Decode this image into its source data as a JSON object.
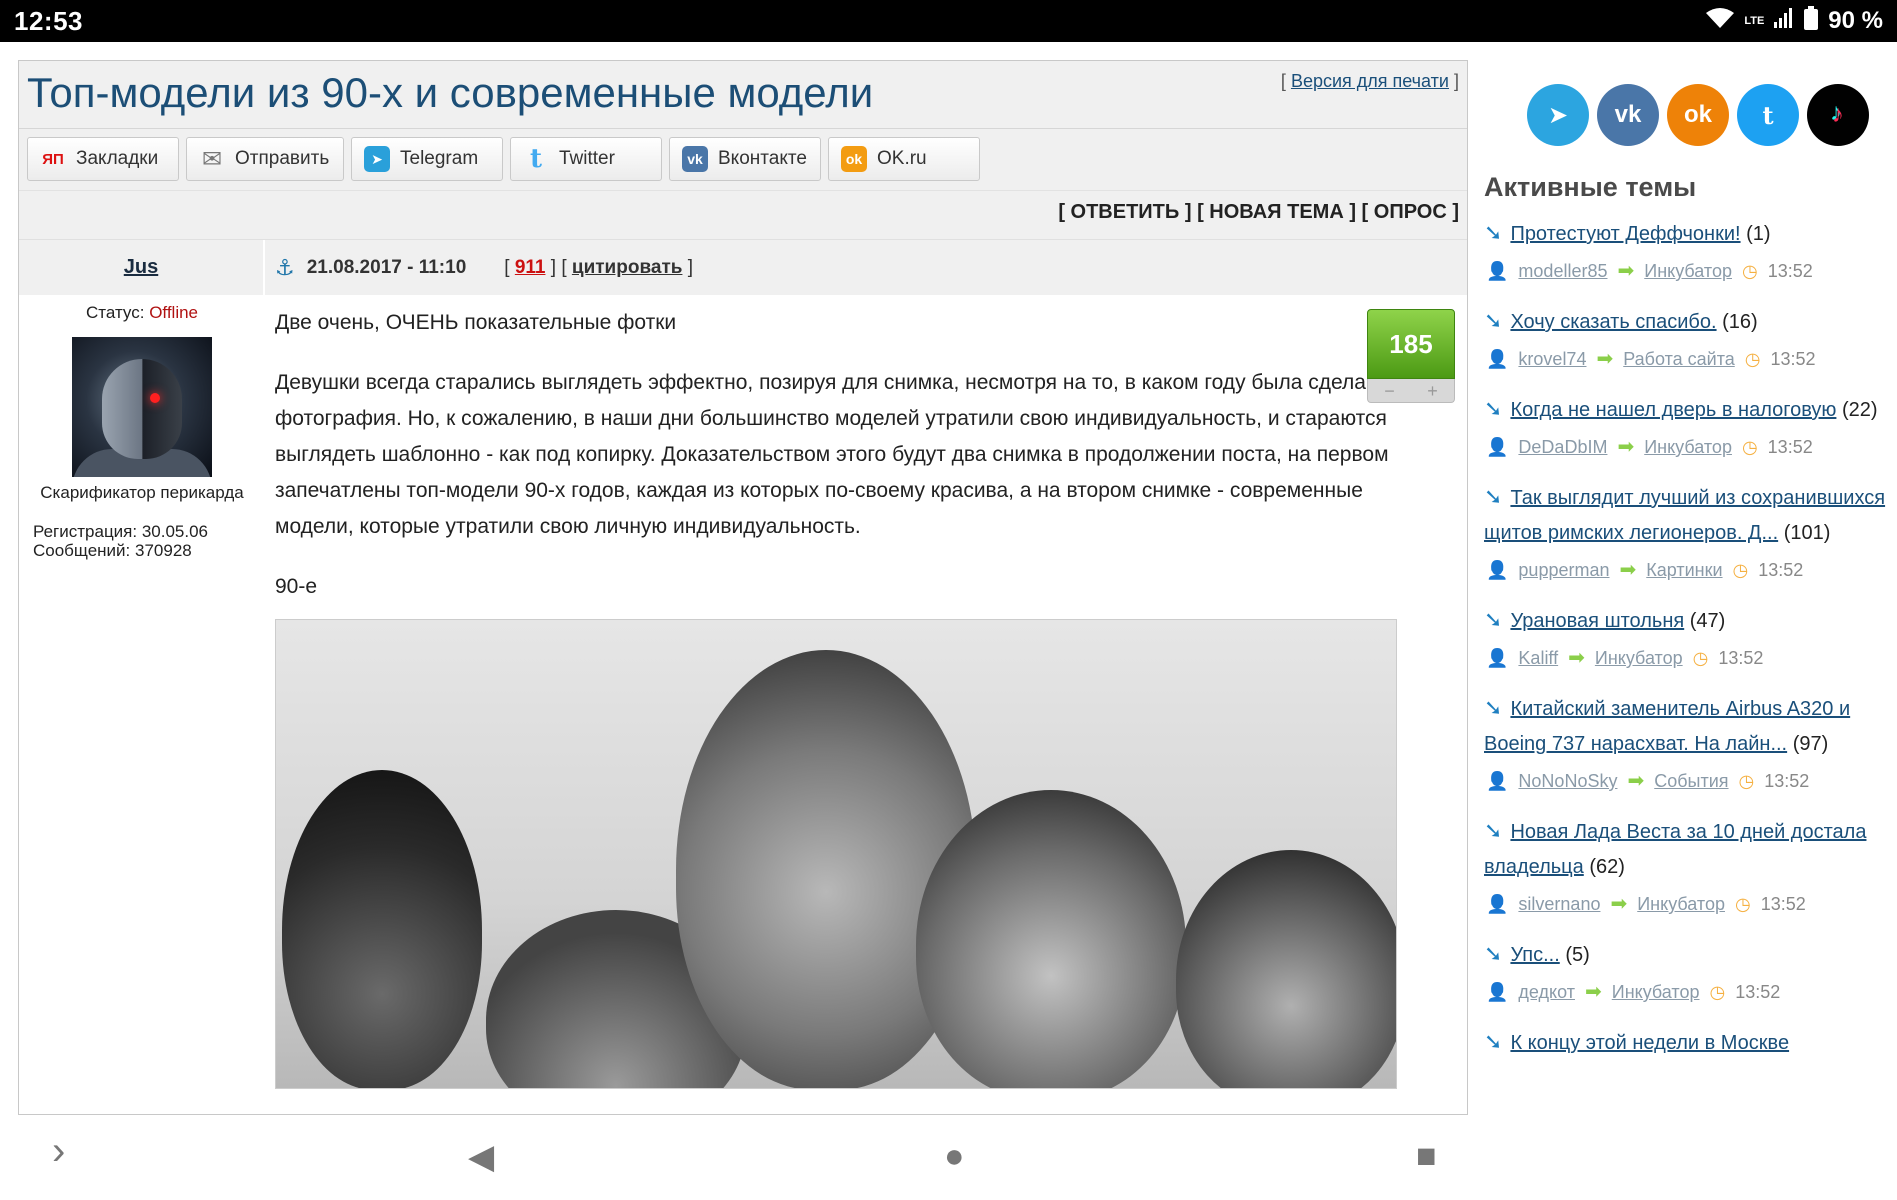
{
  "status_bar": {
    "time": "12:53",
    "network": "LTE",
    "battery": "90 %"
  },
  "page": {
    "title": "Топ-модели из 90-х и современные модели",
    "print_link": "Версия для печати"
  },
  "share": [
    {
      "label": "Закладки",
      "icon": "yandex-icon",
      "icon_text": "ЯП",
      "color": "#d11"
    },
    {
      "label": "Отправить",
      "icon": "mail-icon",
      "icon_text": "✉",
      "color": "#777"
    },
    {
      "label": "Telegram",
      "icon": "telegram-icon",
      "icon_text": "➤",
      "color": "#2aa0da"
    },
    {
      "label": "Twitter",
      "icon": "twitter-icon",
      "icon_text": "t",
      "color": "#42aaf0"
    },
    {
      "label": "Вконтакте",
      "icon": "vk-icon",
      "icon_text": "vk",
      "color": "#4a76a8"
    },
    {
      "label": "OK.ru",
      "icon": "ok-icon",
      "icon_text": "ok",
      "color": "#f39c12"
    }
  ],
  "actions": {
    "reply": "[ ОТВЕТИТЬ ]",
    "new_topic": "[ НОВАЯ ТЕМА ]",
    "poll": "[ ОПРОС ]"
  },
  "post": {
    "author": "Jus",
    "date": "21.08.2017 - 11:10",
    "number": "911",
    "quote": "цитировать",
    "status_label": "Статус:",
    "status_value": "Offline",
    "rank": "Скарификатор перикарда",
    "registration": "Регистрация: 30.05.06",
    "messages": "Сообщений: 370928",
    "rating": "185",
    "rating_minus": "−",
    "rating_plus": "+",
    "paragraphs": [
      "Две очень, ОЧЕНЬ показательные фотки",
      "Девушки всегда старались выглядеть эффектно, позируя для снимка, несмотря на то, в каком году была сделана фотография. Но, к сожалению, в наши дни большинство моделей утратили свою индивидуальность, и стараются выглядеть шаблонно - как под копирку. Доказательством этого будут два снимка в продолжении поста, на первом запечатлены топ-модели 90-х годов, каждая из которых по-своему красива, а на втором снимке - современные модели, которые утратили свою личную индивидуальность.",
      "90-е"
    ]
  },
  "sidebar": {
    "socials": [
      {
        "name": "telegram",
        "icon": "telegram-icon",
        "glyph": "➤",
        "color": "#2ca5e0"
      },
      {
        "name": "vk",
        "icon": "vk-icon",
        "glyph": "vk",
        "color": "#4a76a8"
      },
      {
        "name": "ok",
        "icon": "ok-icon",
        "glyph": "ok",
        "color": "#ee8208"
      },
      {
        "name": "twitter",
        "icon": "twitter-icon",
        "glyph": "t",
        "color": "#1da1f2"
      },
      {
        "name": "tiktok",
        "icon": "tiktok-icon",
        "glyph": "♪",
        "color": "#010101"
      }
    ],
    "title": "Активные темы",
    "topics": [
      {
        "title": "Протестуют Деффчонки!",
        "count": "(1)",
        "user": "modeller85",
        "section": "Инкубатор",
        "time": "13:52"
      },
      {
        "title": "Хочу сказать спасибо.",
        "count": "(16)",
        "user": "krovel74",
        "section": "Работа сайта",
        "time": "13:52"
      },
      {
        "title": "Когда не нашел дверь в налоговую",
        "count": "(22)",
        "user": "DeDaDbIM",
        "section": "Инкубатор",
        "time": "13:52"
      },
      {
        "title": "Так выглядит лучший из сохранившихся щитов римских легионеров. Д...",
        "count": "(101)",
        "user": "pupperman",
        "section": "Картинки",
        "time": "13:52"
      },
      {
        "title": "Урановая штольня",
        "count": "(47)",
        "user": "Kaliff",
        "section": "Инкубатор",
        "time": "13:52"
      },
      {
        "title": "Китайский заменитель Airbus A320 и Boeing 737 нарасхват. На лайн...",
        "count": "(97)",
        "user": "NoNoNoSky",
        "section": "События",
        "time": "13:52"
      },
      {
        "title": "Новая Лада Веста за 10 дней достала владельца",
        "count": "(62)",
        "user": "silvernano",
        "section": "Инкубатор",
        "time": "13:52"
      },
      {
        "title": "Упс...",
        "count": "(5)",
        "user": "дедкот",
        "section": "Инкубатор",
        "time": "13:52"
      },
      {
        "title": "К концу этой недели в Москве",
        "count": "",
        "user": "",
        "section": "",
        "time": ""
      }
    ]
  },
  "navbar": {
    "expand": "›",
    "back": "◀",
    "home": "●",
    "recents": "■"
  }
}
